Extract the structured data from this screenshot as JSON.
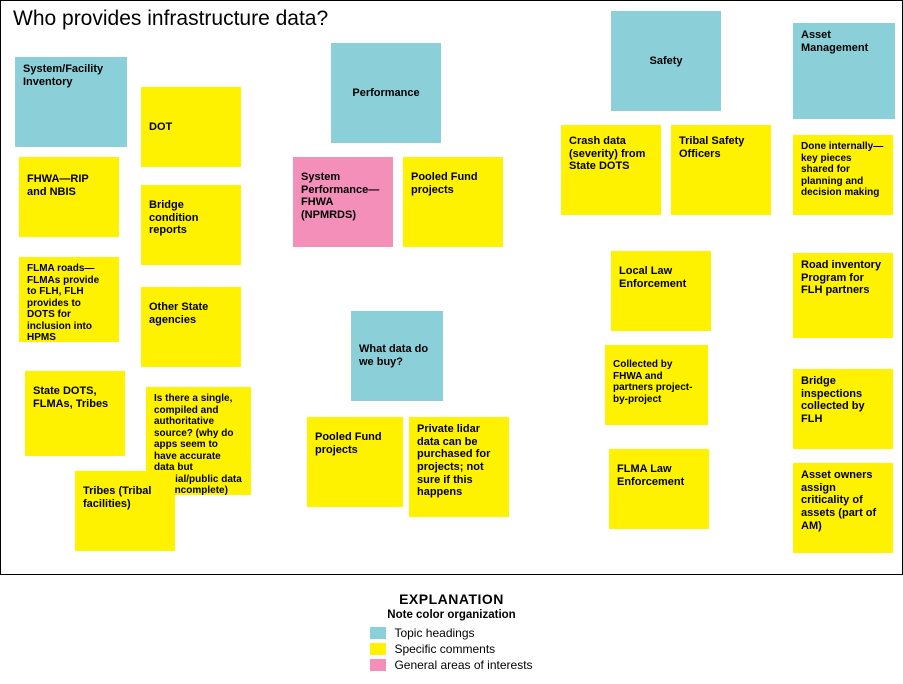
{
  "title": "Who provides infrastructure data?",
  "legend": {
    "heading": "EXPLANATION",
    "subheading": "Note color organization",
    "items": [
      {
        "label": "Topic headings",
        "kind": "topic"
      },
      {
        "label": "Specific comments",
        "kind": "comment"
      },
      {
        "label": "General areas of interests",
        "kind": "general"
      }
    ]
  },
  "notes": {
    "sysfac": {
      "text": "System/Facility Inventory"
    },
    "dot": {
      "text": "DOT"
    },
    "fhwa_rip": {
      "text": "FHWA—RIP and NBIS"
    },
    "bridge": {
      "text": "Bridge condition reports"
    },
    "flma_roads": {
      "text": "FLMA roads—FLMAs provide to FLH, FLH provides to DOTS for inclusion into HPMS"
    },
    "other_state": {
      "text": "Other State agencies"
    },
    "state_dots": {
      "text": "State DOTS, FLMAs, Tribes"
    },
    "single_source": {
      "text": "Is there a single, compiled and authoritative source? (why do apps seem to have accurate data but official/public data are incomplete)"
    },
    "tribes": {
      "text": "Tribes (Tribal facilities)"
    },
    "perf": {
      "text": "Performance"
    },
    "sys_perf": {
      "text": "System Performance—FHWA (NPMRDS)"
    },
    "pooled1": {
      "text": "Pooled Fund projects"
    },
    "what_buy": {
      "text": "What data do we buy?"
    },
    "pooled2": {
      "text": "Pooled Fund projects"
    },
    "lidar": {
      "text": "Private lidar data can be purchased for projects; not sure if this happens"
    },
    "safety": {
      "text": "Safety"
    },
    "crash": {
      "text": "Crash data (severity) from State DOTS"
    },
    "tribalofficers": {
      "text": "Tribal Safety Officers"
    },
    "local_law": {
      "text": "Local Law Enforcement"
    },
    "collected": {
      "text": "Collected by FHWA and partners project-by-project"
    },
    "flma_law": {
      "text": "FLMA Law Enforcement"
    },
    "assetmgmt": {
      "text": "Asset Management"
    },
    "done_int": {
      "text": "Done internally—key pieces shared for planning and decision making"
    },
    "road_inv": {
      "text": "Road inventory Program for FLH partners"
    },
    "bridge_insp": {
      "text": "Bridge inspections collected by FLH"
    },
    "owners": {
      "text": "Asset owners assign criticality of assets (part of AM)"
    }
  }
}
